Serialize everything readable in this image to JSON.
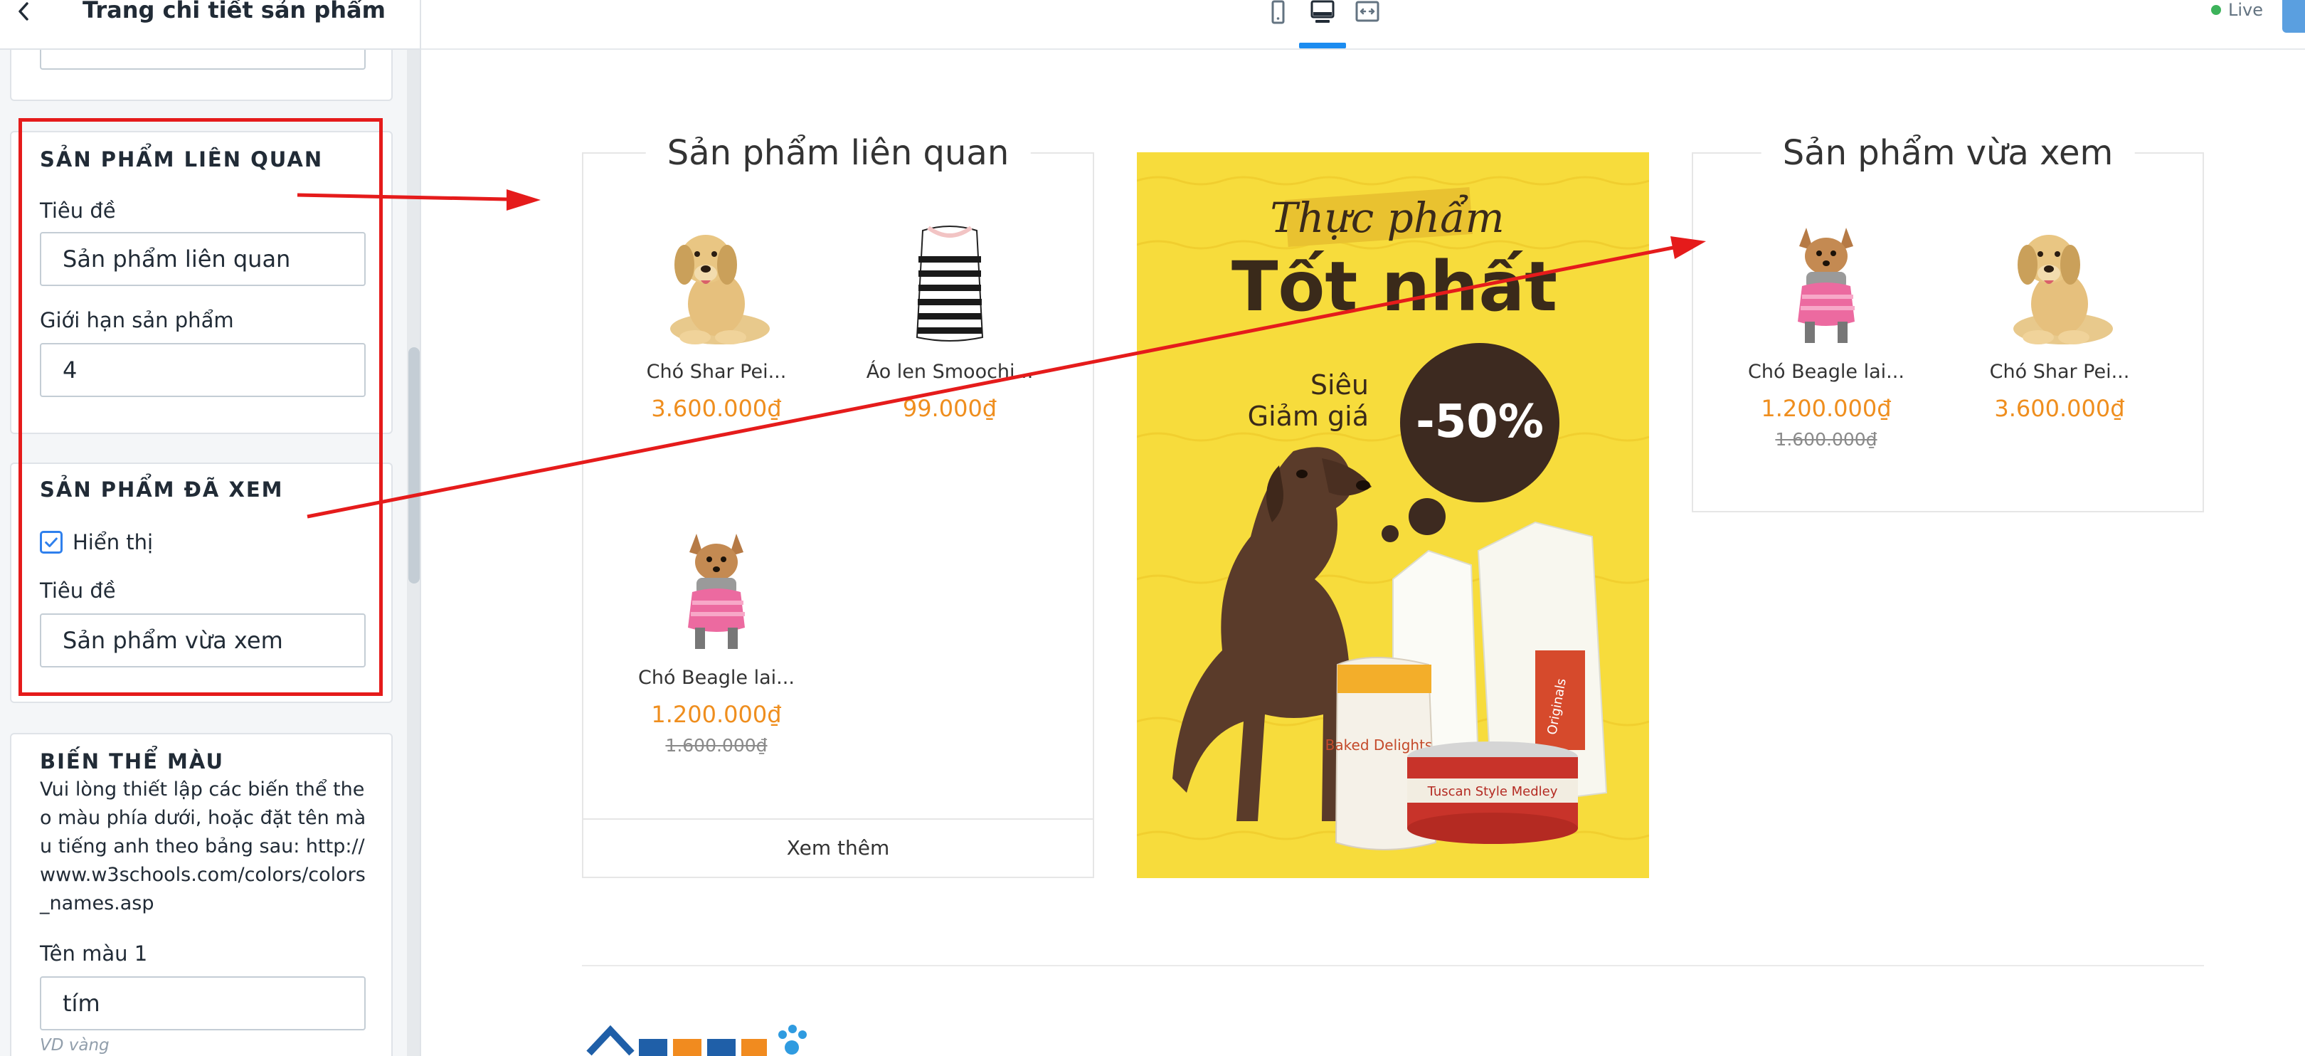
{
  "sidebar": {
    "title": "Trang chi tiết sản phẩm",
    "prev_input_value": "",
    "related": {
      "section_title": "SẢN PHẨM LIÊN QUAN",
      "title_label": "Tiêu đề",
      "title_value": "Sản phẩm liên quan",
      "limit_label": "Giới hạn sản phẩm",
      "limit_value": "4"
    },
    "viewed": {
      "section_title": "SẢN PHẨM ĐÃ XEM",
      "show_label": "Hiển thị",
      "show_checked": true,
      "title_label": "Tiêu đề",
      "title_value": "Sản phẩm vừa xem"
    },
    "color_variant": {
      "section_title": "BIẾN THỂ MÀU",
      "help_text": "Vui lòng thiết lập các biến thể theo màu phía dưới, hoặc đặt tên màu tiếng anh theo bảng sau: http://www.w3schools.com/colors/colors_names.asp",
      "color1_label": "Tên màu 1",
      "color1_value": "tím",
      "color1_hint": "VD vàng"
    }
  },
  "topbar": {
    "devices": [
      "mobile-icon",
      "desktop-icon",
      "fullwidth-icon"
    ],
    "active_device": "desktop-icon",
    "live_label": "Live"
  },
  "preview": {
    "related_widget": {
      "title": "Sản phẩm liên quan",
      "more_label": "Xem thêm",
      "products": [
        {
          "name": "Chó Shar Pei...",
          "price": "3.600.000₫",
          "old_price": "",
          "image": "golden-dog"
        },
        {
          "name": "Áo len Smoochi...",
          "price": "99.000₫",
          "old_price": "",
          "image": "striped-sweater"
        },
        {
          "name": "Chó Beagle lai...",
          "price": "1.200.000₫",
          "old_price": "1.600.000₫",
          "image": "chihuahua-sweater"
        }
      ]
    },
    "banner": {
      "script_text": "Thực phẩm",
      "headline": "Tốt nhất",
      "sale_line1": "Siêu",
      "sale_line2": "Giảm giá",
      "discount": "-50%",
      "bag1_text": "Baked Delights",
      "bag2_text": "Originals",
      "can_text": "Tuscan Style Medley"
    },
    "viewed_widget": {
      "title": "Sản phẩm vừa xem",
      "products": [
        {
          "name": "Chó Beagle lai...",
          "price": "1.200.000₫",
          "old_price": "1.600.000₫",
          "image": "chihuahua-sweater"
        },
        {
          "name": "Chó Shar Pei...",
          "price": "3.600.000₫",
          "old_price": "",
          "image": "golden-dog"
        }
      ]
    }
  },
  "colors": {
    "accent": "#2f80ed",
    "price": "#ef8e1e",
    "annotation": "#e51b1b",
    "live": "#3db35b",
    "banner_bg": "#f7dc3c"
  }
}
